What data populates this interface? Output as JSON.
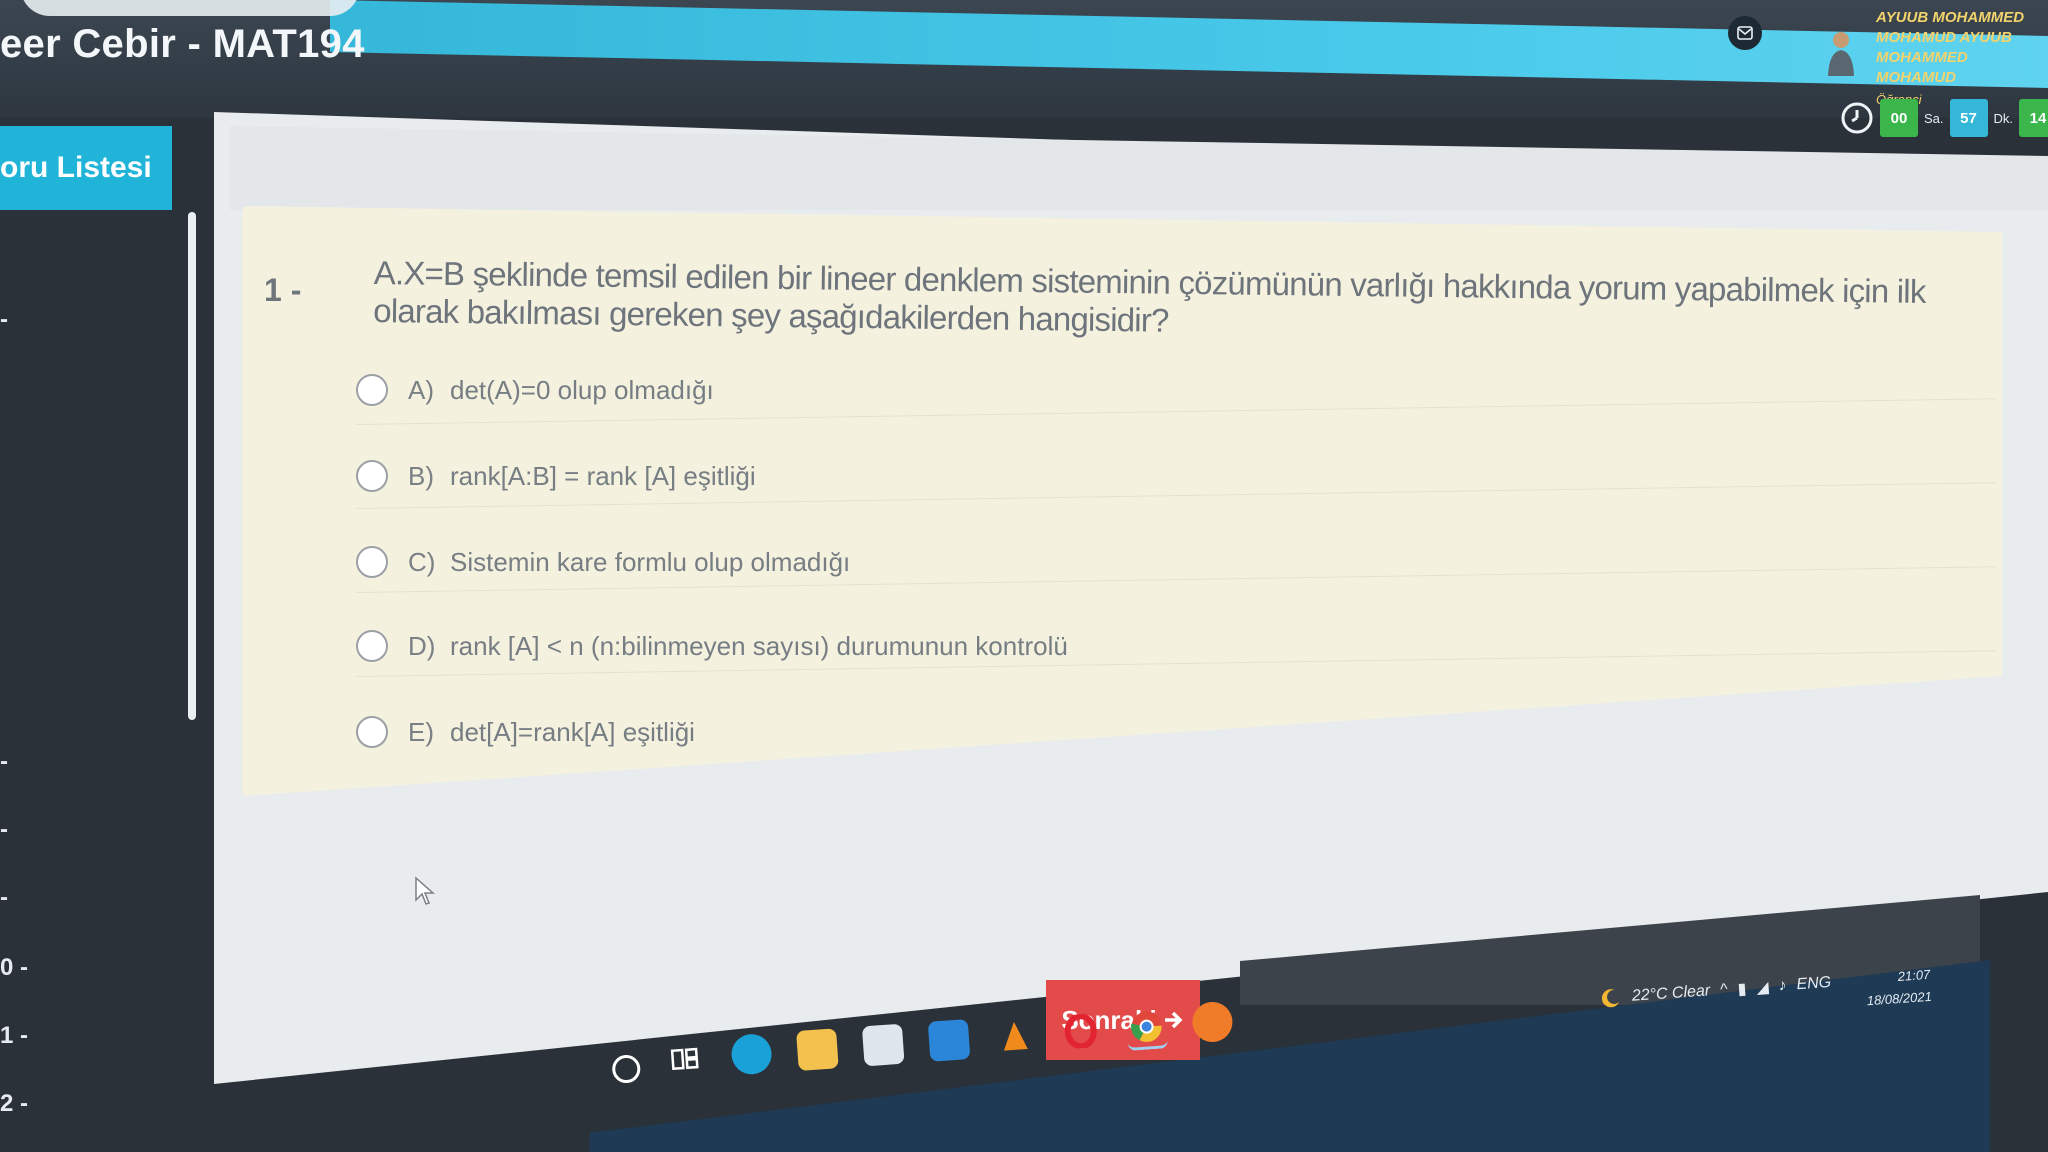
{
  "header": {
    "course_title": "eer Cebir - MAT194",
    "user_lines": [
      "AYUUB MOHAMMED",
      "MOHAMUD AYUUB",
      "MOHAMMED",
      "MOHAMUD"
    ],
    "user_role": "Öğrenci",
    "timer": {
      "hours": "00",
      "hours_unit": "Sa.",
      "minutes": "57",
      "minutes_unit": "Dk.",
      "seconds": "14"
    },
    "icons": {
      "mail": "mail-icon",
      "avatar": "user-avatar-icon",
      "clock": "clock-icon"
    }
  },
  "sidebar": {
    "list_button": "oru Listesi",
    "items": [
      "-",
      "-",
      "-",
      "-",
      "0 -",
      "1 -",
      "2 -"
    ]
  },
  "question": {
    "number": "1 -",
    "text": "A.X=B şeklinde temsil edilen bir lineer denklem sisteminin çözümünün varlığı hakkında yorum yapabilmek için ilk olarak bakılması gereken şey aşağıdakilerden hangisidir?",
    "options": [
      {
        "key": "A)",
        "text": "det(A)=0 olup olmadığı"
      },
      {
        "key": "B)",
        "text": "rank[A:B] = rank [A] eşitliği"
      },
      {
        "key": "C)",
        "text": "Sistemin kare formlu olup olmadığı"
      },
      {
        "key": "D)",
        "text": "rank [A] < n (n:bilinmeyen sayısı) durumunun kontrolü"
      },
      {
        "key": "E)",
        "text": "det[A]=rank[A] eşitliği"
      }
    ]
  },
  "navigation": {
    "next_label": "Sonraki",
    "next_icon": "arrow-right-icon"
  },
  "taskbar": {
    "weather": "22°C Clear",
    "language": "ENG",
    "time": "21:07",
    "date": "18/08/2021",
    "apps": [
      "search-icon",
      "task-view-icon",
      "edge-icon",
      "file-explorer-icon",
      "store-icon",
      "mail-app-icon",
      "vlc-icon",
      "opera-icon",
      "chrome-icon",
      "app-icon"
    ]
  },
  "colors": {
    "accent": "#1fb4d8",
    "next_button": "#e34b4b",
    "timer_green": "#3bb64a",
    "card": "#f4f1df"
  }
}
